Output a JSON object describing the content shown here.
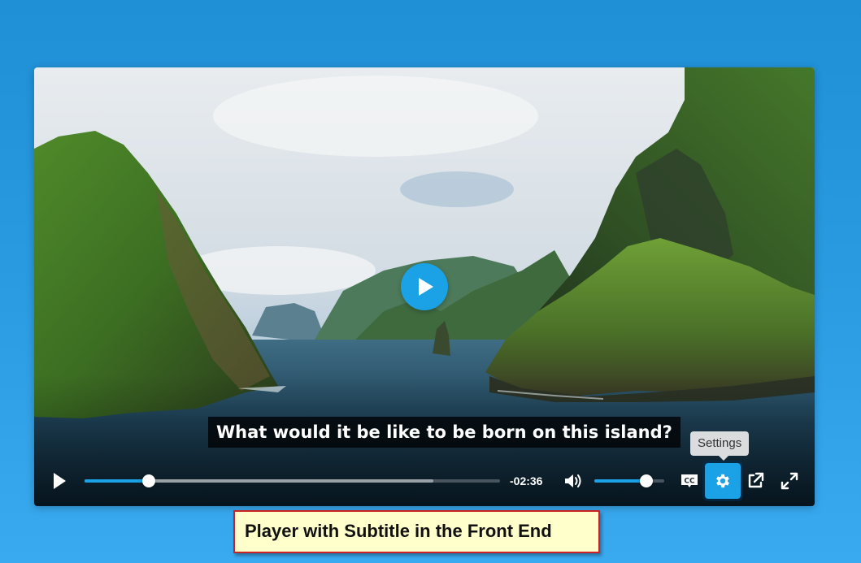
{
  "player": {
    "subtitle_text": "What would it be like to be born on this island?",
    "time_remaining": "-02:36",
    "progress": 0.155,
    "buffered": 0.84,
    "volume": 0.74,
    "settings_tooltip": "Settings",
    "accent_color": "#1aa1e6",
    "icons": [
      "play-icon",
      "volume-icon",
      "closed-captions-icon",
      "gear-icon",
      "popout-icon",
      "fullscreen-icon"
    ]
  },
  "annotation": {
    "caption": "Player with Subtitle in the Front End"
  }
}
